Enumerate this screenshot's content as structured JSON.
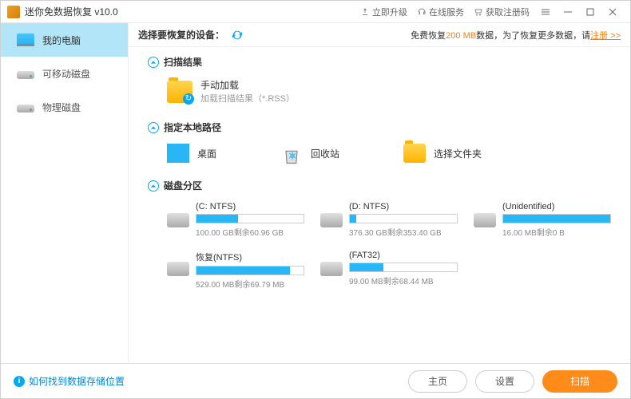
{
  "titlebar": {
    "title": "迷你免数据恢复 v10.0",
    "upgrade": "立即升级",
    "online_service": "在线服务",
    "get_reg_code": "获取注册码"
  },
  "sidebar": {
    "my_computer": "我的电脑",
    "removable_disk": "可移动磁盘",
    "physical_disk": "物理磁盘"
  },
  "header": {
    "select_device": "选择要恢复的设备：",
    "promo_prefix": "免费恢复",
    "promo_amount": "200 MB",
    "promo_suffix": "数据，为了恢复更多数据，请",
    "promo_link": "注册 >>"
  },
  "sections": {
    "scan_result": "扫描结果",
    "manual_load": "手动加载",
    "manual_load_sub": "加载扫描结果（*.RSS）",
    "specify_path": "指定本地路径",
    "desktop": "桌面",
    "recycle_bin": "回收站",
    "select_folder": "选择文件夹",
    "partitions": "磁盘分区"
  },
  "partitions": [
    {
      "label": "(C: NTFS)",
      "total": "100.00 GB",
      "free_label": "剩余",
      "free": "60.96 GB",
      "used_pct": 39
    },
    {
      "label": "(D: NTFS)",
      "total": "376.30 GB",
      "free_label": "剩余",
      "free": "353.40 GB",
      "used_pct": 6
    },
    {
      "label": "(Unidentified)",
      "total": "16.00 MB",
      "free_label": "剩余",
      "free": "0 B",
      "used_pct": 100
    },
    {
      "label": "恢复(NTFS)",
      "total": "529.00 MB",
      "free_label": "剩余",
      "free": "69.79 MB",
      "used_pct": 87
    },
    {
      "label": "(FAT32)",
      "total": "99.00 MB",
      "free_label": "剩余",
      "free": "68.44 MB",
      "used_pct": 31
    }
  ],
  "footer": {
    "help": "如何找到数据存储位置",
    "home": "主页",
    "settings": "设置",
    "scan": "扫描"
  }
}
